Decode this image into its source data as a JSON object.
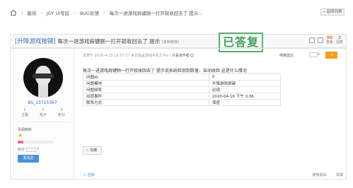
{
  "breadcrumb": {
    "items": [
      "版块",
      "JOY UI专区",
      "BUG反馈",
      "每次一进游戏肩键刚一打开就收回去了 提示..."
    ]
  },
  "back_label": "« 返回列表",
  "title": {
    "prefix": "[升降游戏按键]",
    "text": "每次一进游戏肩键刚一打开就收回去了 提示",
    "tag": "[复制链接]"
  },
  "stamp": "已答复",
  "stats": {
    "views_value": "90",
    "views_label": "查看",
    "replies_value": "2",
    "replies_label": "回复"
  },
  "user": {
    "name": "BS_13725367",
    "topics_value": "1",
    "topics_label": "主题",
    "posts_value": "1",
    "posts_label": "帖子",
    "credits_value": "3",
    "credits_label": "积分",
    "rank": "青铜萌新",
    "points_label": "积分",
    "points_value": "7",
    "level_progress": 0.15,
    "message_button": "发消息"
  },
  "post": {
    "meta_date": "发表于  2020-4-23 15:37:27 来自黑鲨游戏手机3 Pro",
    "meta_sep": "|",
    "meta_link": "只看该作者",
    "sort_label": "电梯直达",
    "first_line": "每次一进游戏肩键刚一打开就收回去了 提示说系统检测到跌落，自动收回  这是什么情况",
    "table": [
      {
        "key": "问题ID",
        "value": "0"
      },
      {
        "key": "问题模块",
        "value": "升降游戏按键"
      },
      {
        "key": "问题频率",
        "value": "必现"
      },
      {
        "key": "出现事件",
        "value": "2020-04-18 下午 3:36"
      },
      {
        "key": "联系方式",
        "value": "保密"
      }
    ],
    "fav_label": "收藏",
    "reply_label": "回复",
    "use_props": "使用道具",
    "report": "举报"
  },
  "colors": {
    "accent_blue": "#3a6dbb",
    "stamp_green": "#46a25c",
    "orange": "#f29c1f"
  }
}
